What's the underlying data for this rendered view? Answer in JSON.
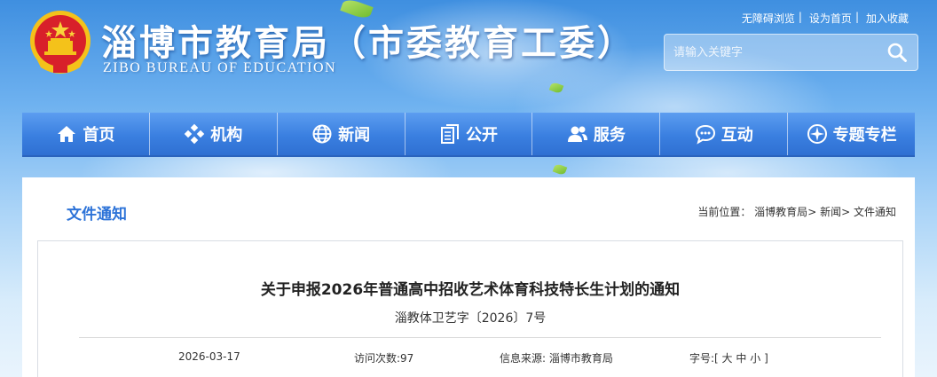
{
  "header": {
    "title": "淄博市教育局（市委教育工委）",
    "subtitle": "ZIBO BUREAU OF EDUCATION",
    "top_links": [
      "无障碍浏览",
      "设为首页",
      "加入收藏"
    ],
    "search_placeholder": "请输入关键字"
  },
  "nav": [
    {
      "label": "首页",
      "icon": "home-icon"
    },
    {
      "label": "机构",
      "icon": "organization-icon"
    },
    {
      "label": "新闻",
      "icon": "globe-icon"
    },
    {
      "label": "公开",
      "icon": "documents-icon"
    },
    {
      "label": "服务",
      "icon": "users-icon"
    },
    {
      "label": "互动",
      "icon": "chat-icon"
    },
    {
      "label": "专题专栏",
      "icon": "compass-icon"
    }
  ],
  "section": {
    "title": "文件通知",
    "breadcrumb_prefix": "当前位置：",
    "breadcrumb": [
      "淄博教育局",
      "新闻",
      "文件通知"
    ],
    "breadcrumb_sep": ">"
  },
  "article": {
    "title": "关于申报2026年普通高中招收艺术体育科技特长生计划的通知",
    "doc_number": "淄教体卫艺字〔2026〕7号",
    "date": "2026-03-17",
    "visits_label": "访问次数:",
    "visits": "97",
    "source_label": "信息来源:",
    "source": "淄博市教育局",
    "font_size_label": "字号:",
    "font_size_options": [
      "大",
      "中",
      "小"
    ]
  },
  "colors": {
    "accent": "#2d73d8",
    "nav_bg": "#3a7fe0"
  }
}
